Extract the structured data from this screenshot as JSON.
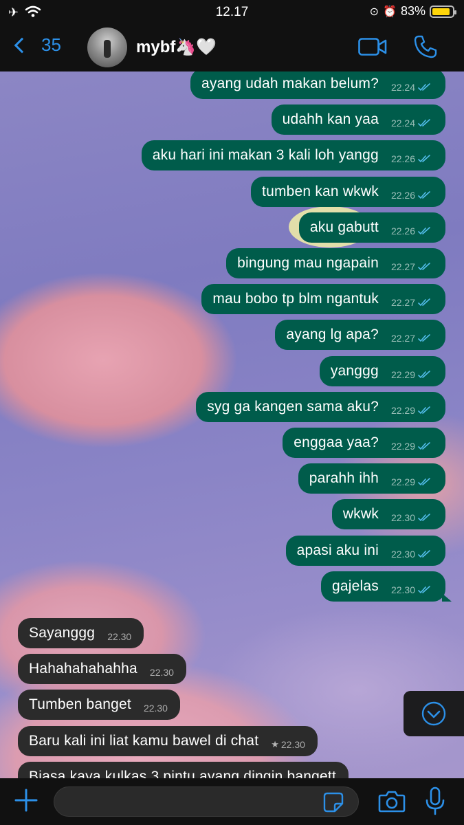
{
  "status_bar": {
    "time": "12.17",
    "battery": "83%",
    "battery_level": 0.83
  },
  "header": {
    "back_count": "35",
    "contact_name": "mybf🦄🤍"
  },
  "colors": {
    "outgoing": "#005c4b",
    "incoming": "#2b2b2b",
    "accent": "#2c90e8",
    "tick": "#53bdeb"
  },
  "messages": [
    {
      "dir": "out",
      "text": "ayang udah makan belum?",
      "time": "22.24",
      "read": true
    },
    {
      "dir": "out",
      "text": "udahh kan yaa",
      "time": "22.24",
      "read": true
    },
    {
      "dir": "out",
      "text": "aku hari ini makan 3 kali loh yangg",
      "time": "22.26",
      "read": true
    },
    {
      "dir": "out",
      "text": "tumben kan wkwk",
      "time": "22.26",
      "read": true
    },
    {
      "dir": "out",
      "text": "aku gabutt",
      "time": "22.26",
      "read": true
    },
    {
      "dir": "out",
      "text": "bingung mau ngapain",
      "time": "22.27",
      "read": true
    },
    {
      "dir": "out",
      "text": "mau bobo tp blm ngantuk",
      "time": "22.27",
      "read": true
    },
    {
      "dir": "out",
      "text": "ayang lg apa?",
      "time": "22.27",
      "read": true
    },
    {
      "dir": "out",
      "text": "yanggg",
      "time": "22.29",
      "read": true
    },
    {
      "dir": "out",
      "text": "syg ga kangen sama aku?",
      "time": "22.29",
      "read": true
    },
    {
      "dir": "out",
      "text": "enggaa yaa?",
      "time": "22.29",
      "read": true
    },
    {
      "dir": "out",
      "text": "parahh ihh",
      "time": "22.29",
      "read": true
    },
    {
      "dir": "out",
      "text": "wkwk",
      "time": "22.30",
      "read": true
    },
    {
      "dir": "out",
      "text": "apasi aku ini",
      "time": "22.30",
      "read": true
    },
    {
      "dir": "out",
      "text": "gajelas",
      "time": "22.30",
      "read": true
    },
    {
      "dir": "in",
      "text": "Sayanggg",
      "time": "22.30"
    },
    {
      "dir": "in",
      "text": "Hahahahahahha",
      "time": "22.30"
    },
    {
      "dir": "in",
      "text": "Tumben banget",
      "time": "22.30"
    },
    {
      "dir": "in",
      "text": "Baru kali ini liat kamu bawel di chat",
      "time": "22.30",
      "starred": true
    },
    {
      "dir": "in",
      "text": "Biasa kaya kulkas 3 pintu ayang dingin bangett",
      "time": ""
    }
  ],
  "composer": {
    "value": "",
    "placeholder": ""
  },
  "icons": {
    "back": "chevron-left-icon",
    "video": "video-camera-icon",
    "call": "phone-icon",
    "plus": "plus-icon",
    "sticker": "sticker-icon",
    "camera": "camera-icon",
    "mic": "microphone-icon",
    "scroll": "chevron-down-icon"
  }
}
